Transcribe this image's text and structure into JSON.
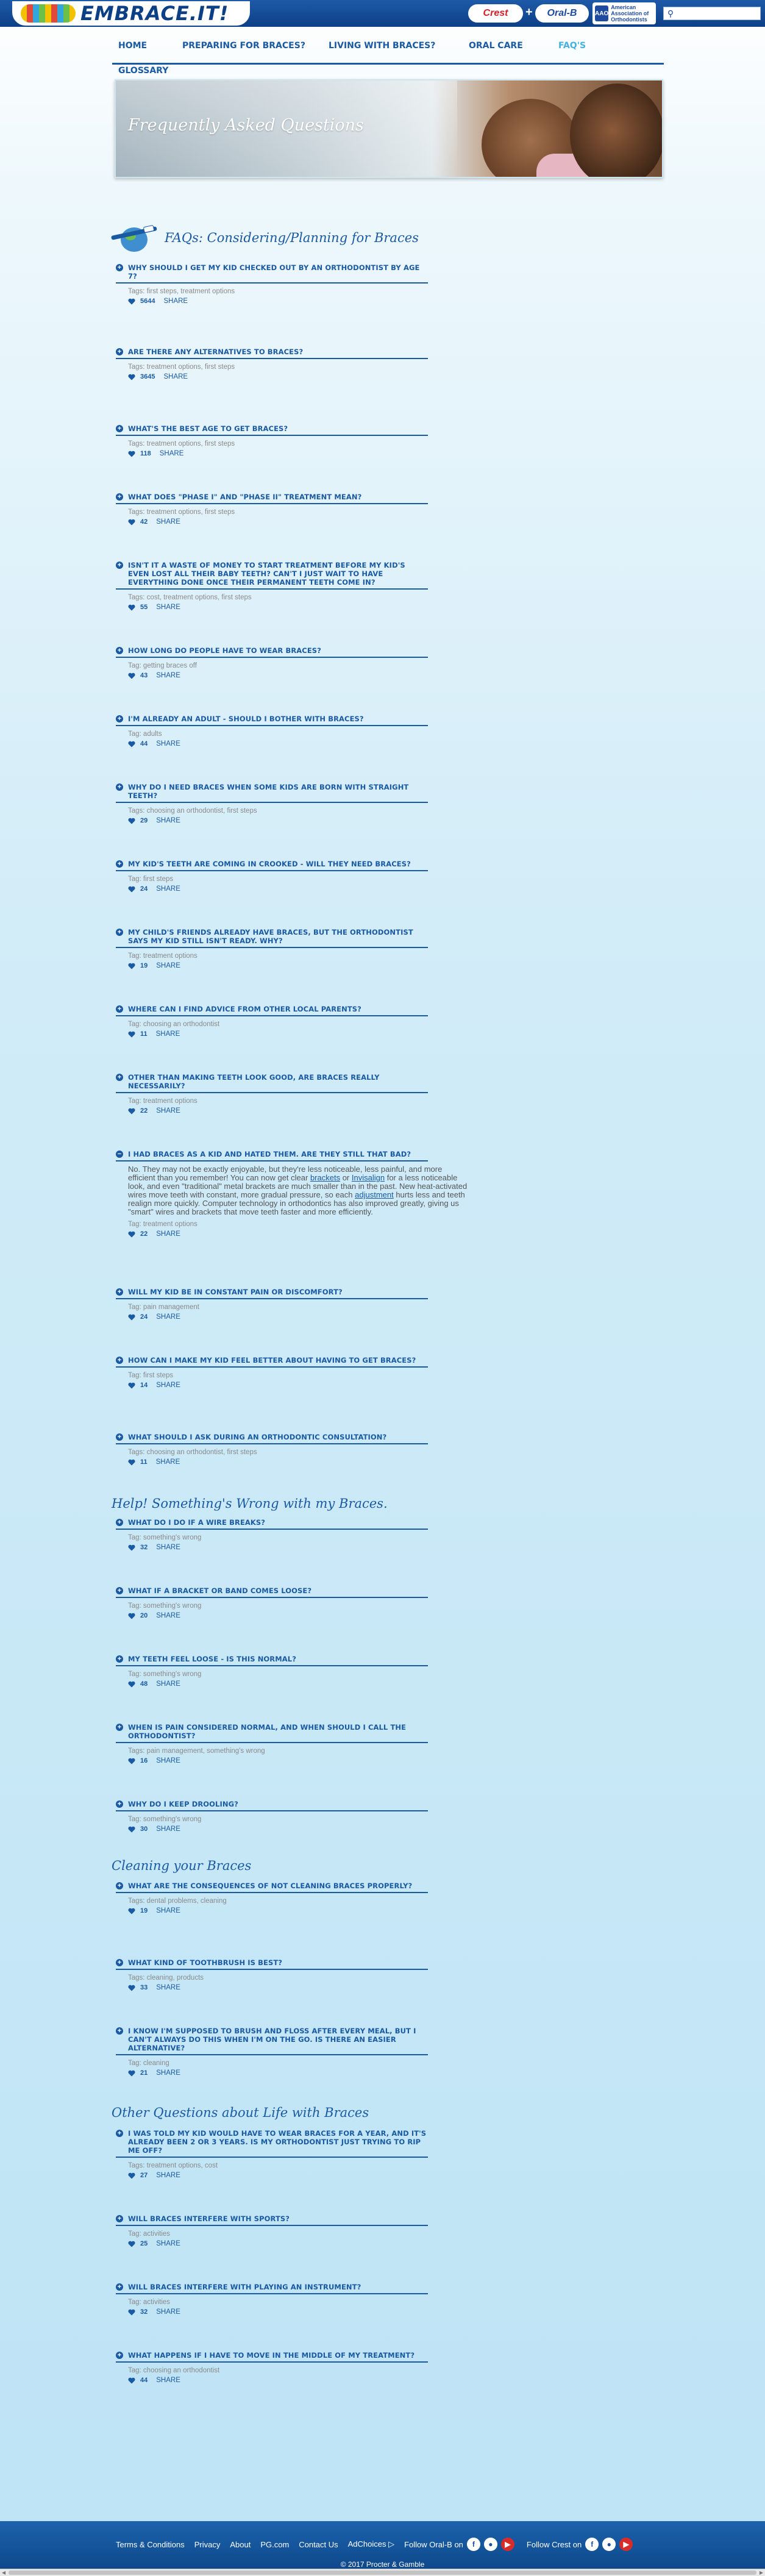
{
  "header": {
    "logo_text": "EMBRACE.IT!",
    "brand_crest": "Crest",
    "brand_plus": "+",
    "brand_oralb": "Oral-B",
    "brand_aao": "American Association of Orthodontists",
    "brand_aao_badge": "AAO",
    "search_placeholder": "",
    "search_icon": "magnifier-icon"
  },
  "nav": {
    "items": [
      {
        "label": "HOME",
        "active": false
      },
      {
        "label": "PREPARING FOR BRACES?",
        "active": false
      },
      {
        "label": "LIVING WITH BRACES?",
        "active": false
      },
      {
        "label": "ORAL CARE",
        "active": false
      },
      {
        "label": "FAQ'S",
        "active": true
      }
    ],
    "glossary": "GLOSSARY"
  },
  "hero": {
    "title": "Frequently Asked Questions"
  },
  "sections": [
    {
      "title": "FAQs: Considering/Planning for Braces"
    },
    {
      "title": "Help! Something's Wrong with my Braces."
    },
    {
      "title": "Cleaning your Braces"
    },
    {
      "title": "Other Questions about Life with Braces"
    }
  ],
  "share_label": "SHARE",
  "faqs": [
    {
      "q": "WHY SHOULD I GET MY KID CHECKED OUT BY AN ORTHODONTIST BY AGE 7?",
      "tags": "Tags: first steps, treatment options",
      "likes": "5644"
    },
    {
      "q": "ARE THERE ANY ALTERNATIVES TO BRACES?",
      "tags": "Tags: treatment options, first steps",
      "likes": "3645"
    },
    {
      "q": "WHAT'S THE BEST AGE TO GET BRACES?",
      "tags": "Tags: treatment options, first steps",
      "likes": "118"
    },
    {
      "q": "WHAT DOES \"PHASE I\" AND \"PHASE II\" TREATMENT MEAN?",
      "tags": "Tags: treatment options, first steps",
      "likes": "42"
    },
    {
      "q": "ISN'T IT A WASTE OF MONEY TO START TREATMENT BEFORE MY KID'S EVEN LOST ALL THEIR BABY TEETH? CAN'T I JUST WAIT TO HAVE EVERYTHING DONE ONCE THEIR PERMANENT TEETH COME IN?",
      "tags": "Tags: cost, treatment options, first steps",
      "likes": "55"
    },
    {
      "q": "HOW LONG DO PEOPLE HAVE TO WEAR BRACES?",
      "tags": "Tag: getting braces off",
      "likes": "43"
    },
    {
      "q": "I'M ALREADY AN ADULT - SHOULD I BOTHER WITH BRACES?",
      "tags": "Tag: adults",
      "likes": "44"
    },
    {
      "q": "WHY DO I NEED BRACES WHEN SOME KIDS ARE BORN WITH STRAIGHT TEETH?",
      "tags": "Tags: choosing an orthodontist, first steps",
      "likes": "29"
    },
    {
      "q": "MY KID'S TEETH ARE COMING IN CROOKED - WILL THEY NEED BRACES?",
      "tags": "Tag: first steps",
      "likes": "24"
    },
    {
      "q": "MY CHILD'S FRIENDS ALREADY HAVE BRACES, BUT THE ORTHODONTIST SAYS MY KID STILL ISN'T READY. WHY?",
      "tags": "Tag: treatment options",
      "likes": "19"
    },
    {
      "q": "WHERE CAN I FIND ADVICE FROM OTHER LOCAL PARENTS?",
      "tags": "Tag: choosing an orthodontist",
      "likes": "11"
    },
    {
      "q": "OTHER THAN MAKING TEETH LOOK GOOD, ARE BRACES REALLY NECESSARILY?",
      "tags": "Tag: treatment options",
      "likes": "22"
    },
    {
      "q": "I HAD BRACES AS A KID AND HATED THEM. ARE THEY STILL THAT BAD?",
      "tags": "Tag: treatment options",
      "likes": "22",
      "answer_a": "No. They may not be exactly enjoyable, but they're less noticeable, less painful, and more efficient than you remember! You can now get clear ",
      "answer_link1": "brackets",
      "answer_b": " or ",
      "answer_link2": "Invisalign",
      "answer_c": " for a less noticeable look, and even \"traditional\" metal brackets are much smaller than in the past. New heat-activated wires move teeth with constant, more gradual pressure, so each ",
      "answer_link3": "adjustment",
      "answer_d": " hurts less and teeth realign more quickly. Computer technology in orthodontics has also improved greatly, giving us \"smart\" wires and brackets that move teeth faster and more efficiently."
    },
    {
      "q": "WILL MY KID BE IN CONSTANT PAIN OR DISCOMFORT?",
      "tags": "Tag: pain management",
      "likes": "24"
    },
    {
      "q": "HOW CAN I MAKE MY KID FEEL BETTER ABOUT HAVING TO GET BRACES?",
      "tags": "Tag: first steps",
      "likes": "14"
    },
    {
      "q": "WHAT SHOULD I ASK DURING AN ORTHODONTIC CONSULTATION?",
      "tags": "Tags: choosing an orthodontist, first steps",
      "likes": "11"
    },
    {
      "q": "WHAT DO I DO IF A WIRE BREAKS?",
      "tags": "Tag: something's wrong",
      "likes": "32"
    },
    {
      "q": "WHAT IF A BRACKET OR BAND COMES LOOSE?",
      "tags": "Tag: something's wrong",
      "likes": "20"
    },
    {
      "q": "MY TEETH FEEL LOOSE - IS THIS NORMAL?",
      "tags": "Tag: something's wrong",
      "likes": "48"
    },
    {
      "q": "WHEN IS PAIN CONSIDERED NORMAL, AND WHEN SHOULD I CALL THE ORTHODONTIST?",
      "tags": "Tags: pain management, something's wrong",
      "likes": "16"
    },
    {
      "q": "WHY DO I KEEP DROOLING?",
      "tags": "Tag: something's wrong",
      "likes": "30"
    },
    {
      "q": "WHAT ARE THE CONSEQUENCES OF NOT CLEANING BRACES PROPERLY?",
      "tags": "Tags: dental problems, cleaning",
      "likes": "19"
    },
    {
      "q": "WHAT KIND OF TOOTHBRUSH IS BEST?",
      "tags": "Tags: cleaning, products",
      "likes": "33"
    },
    {
      "q": "I KNOW I'M SUPPOSED TO BRUSH AND FLOSS AFTER EVERY MEAL, BUT I CAN'T ALWAYS DO THIS WHEN I'M ON THE GO. IS THERE AN EASIER ALTERNATIVE?",
      "tags": "Tag: cleaning",
      "likes": "21"
    },
    {
      "q": "I WAS TOLD MY KID WOULD HAVE TO WEAR BRACES FOR A YEAR, AND IT'S ALREADY BEEN 2 OR 3 YEARS. IS MY ORTHODONTIST JUST TRYING TO RIP ME OFF?",
      "tags": "Tags: treatment options, cost",
      "likes": "27"
    },
    {
      "q": "WILL BRACES INTERFERE WITH SPORTS?",
      "tags": "Tag: activities",
      "likes": "25"
    },
    {
      "q": "WILL BRACES INTERFERE WITH PLAYING AN INSTRUMENT?",
      "tags": "Tag: activities",
      "likes": "32"
    },
    {
      "q": "WHAT HAPPENS IF I HAVE TO MOVE IN THE MIDDLE OF MY TREATMENT?",
      "tags": "Tag: choosing an orthodontist",
      "likes": "44"
    }
  ],
  "footer": {
    "links": [
      "Terms & Conditions",
      "Privacy",
      "About",
      "PG.com",
      "Contact Us",
      "AdChoices"
    ],
    "follow_oralb": "Follow Oral-B on",
    "follow_crest": "Follow Crest on",
    "copyright": "© 2017 Procter & Gamble"
  },
  "colors": {
    "brand_blue": "#1a5aa2",
    "accent": "#43b2e1",
    "tag_gray": "#8a8a8a"
  }
}
